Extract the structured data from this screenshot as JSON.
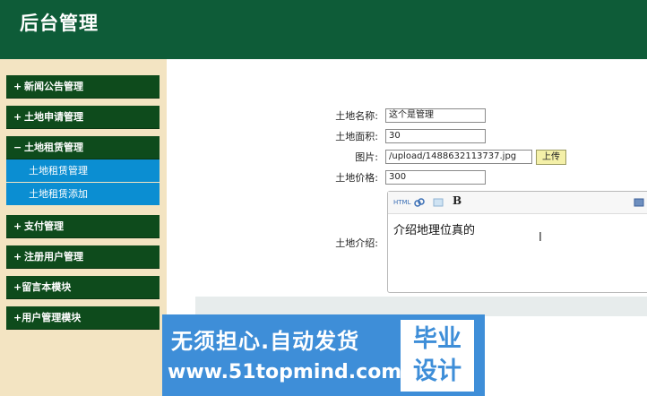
{
  "header": {
    "title": "后台管理"
  },
  "sidebar": {
    "items": [
      {
        "sign": "+",
        "label": "新闻公告管理"
      },
      {
        "sign": "+",
        "label": "土地申请管理"
      },
      {
        "sign": "−",
        "label": "土地租赁管理",
        "sub": [
          "土地租赁管理",
          "土地租赁添加"
        ]
      },
      {
        "sign": "+",
        "label": "支付管理"
      },
      {
        "sign": "+",
        "label": "注册用户管理"
      },
      {
        "sign": "+",
        "label": "留言本模块"
      },
      {
        "sign": "+",
        "label": "用户管理模块"
      }
    ]
  },
  "form": {
    "name_label": "土地名称:",
    "name_value": "这个是管理",
    "area_label": "土地面积:",
    "area_value": "30",
    "image_label": "图片:",
    "image_value": "/upload/1488632113737.jpg",
    "upload_label": "上传",
    "price_label": "土地价格:",
    "price_value": "300",
    "intro_label": "土地介绍:",
    "intro_value": "介绍地理位真的",
    "toolbar_icons": [
      "html-icon",
      "link-icon",
      "image-icon",
      "bold-icon",
      "fullscreen-icon"
    ]
  },
  "watermark": {
    "line1": "无须担心.自动发货",
    "line2": "www.51topmind.com",
    "badge_line1": "毕业",
    "badge_line2": "设计"
  }
}
